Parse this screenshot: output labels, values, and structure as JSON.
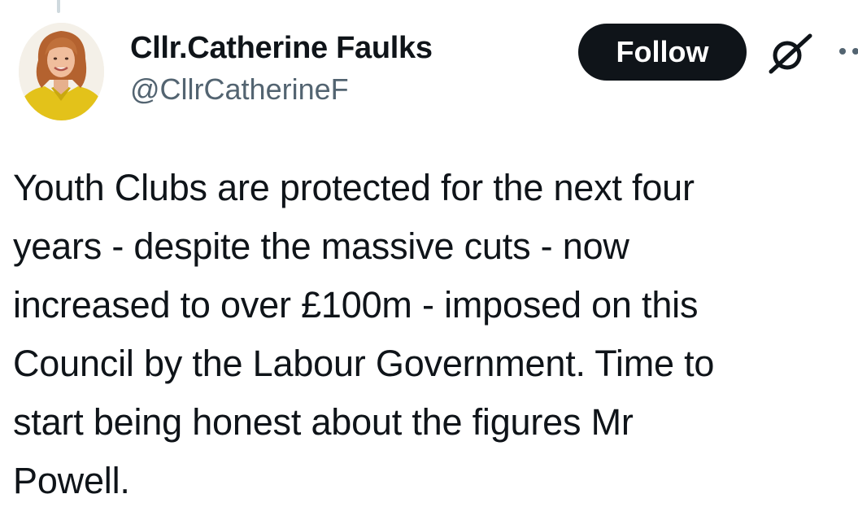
{
  "tweet": {
    "author": {
      "display_name": "Cllr.Catherine Faulks",
      "handle": "@CllrCatherineF",
      "avatar_icon": "profile-photo"
    },
    "follow_label": "Follow",
    "grok_icon": "grok-icon",
    "more_icon": "more-options-icon",
    "text": "Youth Clubs are protected for the next four\nyears - despite the massive cuts - now\nincreased to over £100m - imposed on this\nCouncil by the Labour Government.  Time to\nstart being honest about the figures Mr\nPowell."
  },
  "colors": {
    "follow_bg": "#0f1419",
    "follow_text": "#ffffff",
    "handle": "#536471",
    "text": "#0f1419",
    "thread_line": "#cfd9de"
  }
}
